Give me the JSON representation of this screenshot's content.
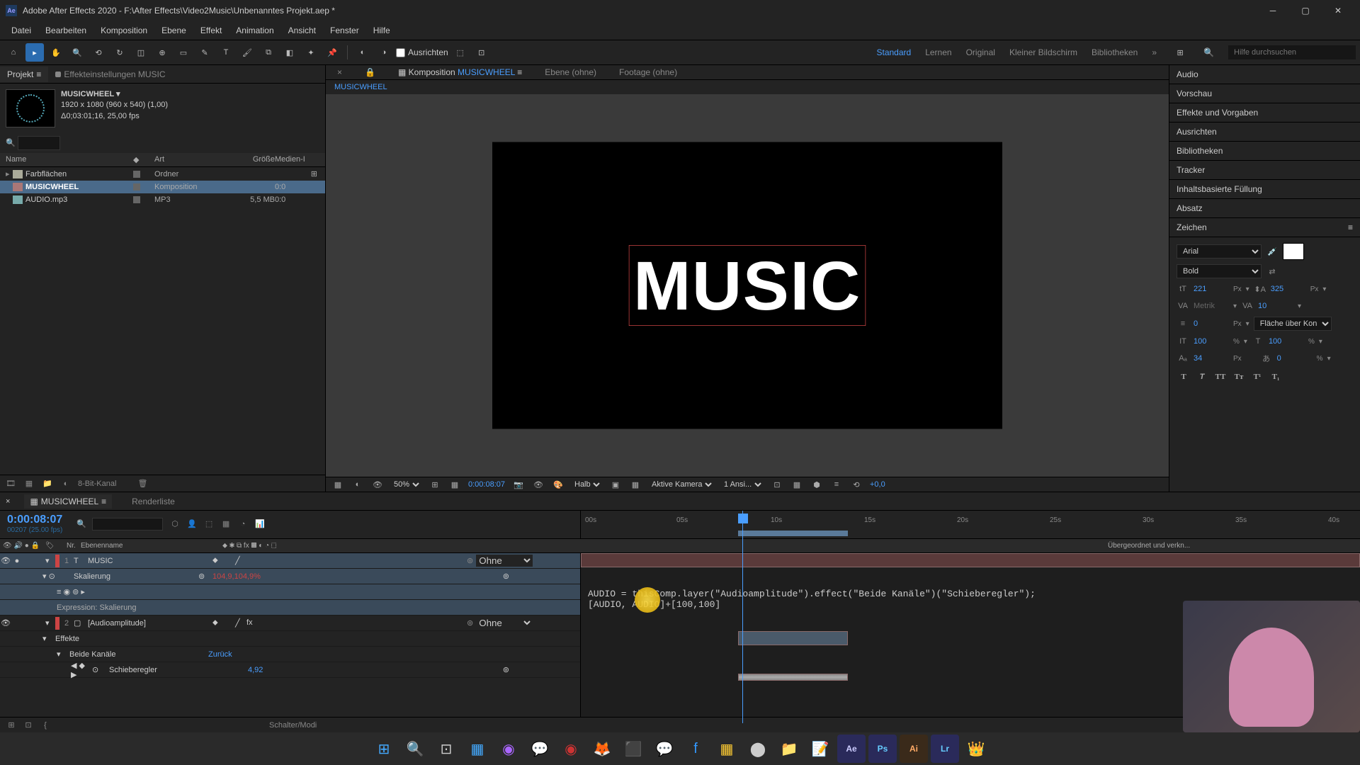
{
  "titlebar": {
    "icon_label": "Ae",
    "title": "Adobe After Effects 2020 - F:\\After Effects\\Video2Music\\Unbenanntes Projekt.aep *"
  },
  "menu": [
    "Datei",
    "Bearbeiten",
    "Komposition",
    "Ebene",
    "Effekt",
    "Animation",
    "Ansicht",
    "Fenster",
    "Hilfe"
  ],
  "toolbar": {
    "ausrichten": "Ausrichten",
    "workspaces": [
      "Standard",
      "Lernen",
      "Original",
      "Kleiner Bildschirm",
      "Bibliotheken"
    ],
    "active_workspace": "Standard",
    "search_placeholder": "Hilfe durchsuchen"
  },
  "project": {
    "tab_project": "Projekt",
    "tab_effects": "Effekteinstellungen  MUSIC",
    "comp_name": "MUSICWHEEL",
    "comp_dims": "1920 x 1080 (960 x 540) (1,00)",
    "comp_dur": "Δ0;03:01;16, 25,00 fps",
    "headers": {
      "name": "Name",
      "type": "Art",
      "size": "Größe",
      "media": "Medien-I"
    },
    "items": [
      {
        "name": "Farbflächen",
        "type": "Ordner",
        "size": "",
        "dur": "",
        "icon": "folder",
        "arrow": "▸"
      },
      {
        "name": "MUSICWHEEL",
        "type": "Komposition",
        "size": "",
        "dur": "0:0",
        "icon": "comp",
        "arrow": "",
        "sel": true
      },
      {
        "name": "AUDIO.mp3",
        "type": "MP3",
        "size": "5,5 MB",
        "dur": "0:0",
        "icon": "audio",
        "arrow": ""
      }
    ],
    "footer_depth": "8-Bit-Kanal"
  },
  "comp_viewer": {
    "tab_comp": "Komposition",
    "tab_comp_name": "MUSICWHEEL",
    "tab_layer": "Ebene  (ohne)",
    "tab_footage": "Footage  (ohne)",
    "breadcrumb": "MUSICWHEEL",
    "text": "MUSIC",
    "zoom": "50%",
    "timecode": "0:00:08:07",
    "res": "Halb",
    "camera": "Aktive Kamera",
    "views": "1 Ansi...",
    "exposure": "+0,0"
  },
  "right_panels": [
    "Audio",
    "Vorschau",
    "Effekte und Vorgaben",
    "Ausrichten",
    "Bibliotheken",
    "Tracker",
    "Inhaltsbasierte Füllung",
    "Absatz"
  ],
  "char": {
    "title": "Zeichen",
    "font": "Arial",
    "weight": "Bold",
    "size": "221",
    "size_unit": "Px",
    "leading": "325",
    "leading_unit": "Px",
    "kerning": "Metrik",
    "tracking": "10",
    "stroke": "0",
    "stroke_unit": "Px",
    "stroke_opt": "Fläche über Kon...",
    "vscale": "100",
    "hscale": "100",
    "scale_unit": "%",
    "baseline": "34",
    "baseline_unit": "Px",
    "tsume": "0",
    "tsume_unit": "%"
  },
  "timeline": {
    "tab_name": "MUSICWHEEL",
    "tab_render": "Renderliste",
    "timecode": "0:00:08:07",
    "frames": "00207 (25.00 fps)",
    "col_nr": "Nr.",
    "col_layer": "Ebenenname",
    "col_parent": "Übergeordnet und verkn...",
    "ticks": [
      "00s",
      "05s",
      "10s",
      "15s",
      "20s",
      "25s",
      "30s",
      "35s",
      "40s"
    ],
    "layers": [
      {
        "num": "1",
        "name": "MUSIC",
        "parent": "Ohne",
        "color": "#c44",
        "type": "T"
      },
      {
        "prop": "Skalierung",
        "val": "104,9,104,9%"
      },
      {
        "expr_label": "Expression: Skalierung"
      },
      {
        "num": "2",
        "name": "[Audioamplitude]",
        "parent": "Ohne",
        "color": "#c44",
        "type": "solid"
      },
      {
        "prop": "Effekte"
      },
      {
        "prop": "Beide Kanäle",
        "val2": "Zurück"
      },
      {
        "prop": "Schieberegler",
        "val2": "4,92"
      }
    ],
    "expression": "AUDIO = thisComp.layer(\"Audioamplitude\").effect(\"Beide Kanäle\")(\"Schieberegler\");\n[AUDIO, AUDIO]+[100,100]",
    "footer": "Schalter/Modi"
  },
  "taskbar_icons": [
    "windows",
    "search",
    "taskview",
    "explorer",
    "app1",
    "whatsapp",
    "app2",
    "firefox",
    "app3",
    "messenger",
    "facebook",
    "app4",
    "obs",
    "folder",
    "notepad",
    "ae",
    "ps",
    "ai",
    "lr",
    "app5"
  ]
}
